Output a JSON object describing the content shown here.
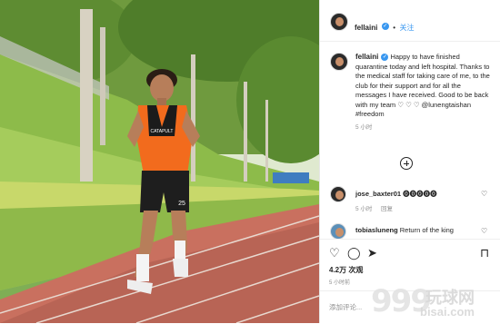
{
  "post": {
    "username": "fellaini",
    "follow_label": "关注",
    "caption": "Happy to have finished quarantine today and left hospital. Thanks to the medical staff for taking care of me, to the club for their support and for all the messages I have received. Good to be back with my team ♡ ♡ ♡ @lunengtaishan #freedom",
    "caption_time": "5 小时",
    "comments": [
      {
        "username": "jose_baxter01",
        "text": "⓿⓿⓿⓿⓿",
        "time": "5 小时",
        "reply": "回复"
      },
      {
        "username": "tobiasluneng",
        "text": "Return of the king"
      }
    ],
    "views": "4.2万 次观",
    "posted_ago": "5 小时前",
    "add_comment_placeholder": "添加评论..."
  },
  "photo": {
    "shirt_text": "CATAPULT",
    "shorts_number": "25"
  },
  "watermark": {
    "digits": "999",
    "brand": "玩球网",
    "site": "bisai.com"
  },
  "icons": [
    "heart-icon",
    "comment-icon",
    "share-icon",
    "bookmark-icon",
    "verified-icon",
    "add-more-icon"
  ],
  "colors": {
    "link": "#3897f0",
    "text": "#262626",
    "muted": "#8e8e8e",
    "shirt": "#f26b1d",
    "track": "#c96a5a"
  }
}
